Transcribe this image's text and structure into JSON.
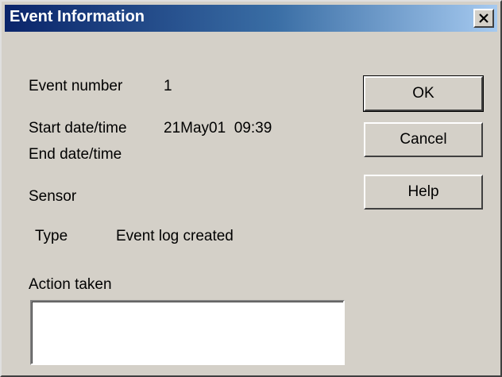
{
  "window": {
    "title": "Event Information",
    "close_icon": "close-icon"
  },
  "fields": {
    "event_number_label": "Event number",
    "event_number_value": "1",
    "start_label": "Start date/time",
    "start_value": "21May01  09:39",
    "end_label": "End date/time",
    "end_value": "",
    "sensor_label": "Sensor",
    "type_label": "Type",
    "type_value": "Event log created",
    "action_label": "Action taken",
    "action_value": ""
  },
  "buttons": {
    "ok": "OK",
    "cancel": "Cancel",
    "help": "Help"
  },
  "colors": {
    "titlebar_start": "#0a246a",
    "titlebar_end": "#a6caf0",
    "face": "#d4d0c8"
  }
}
